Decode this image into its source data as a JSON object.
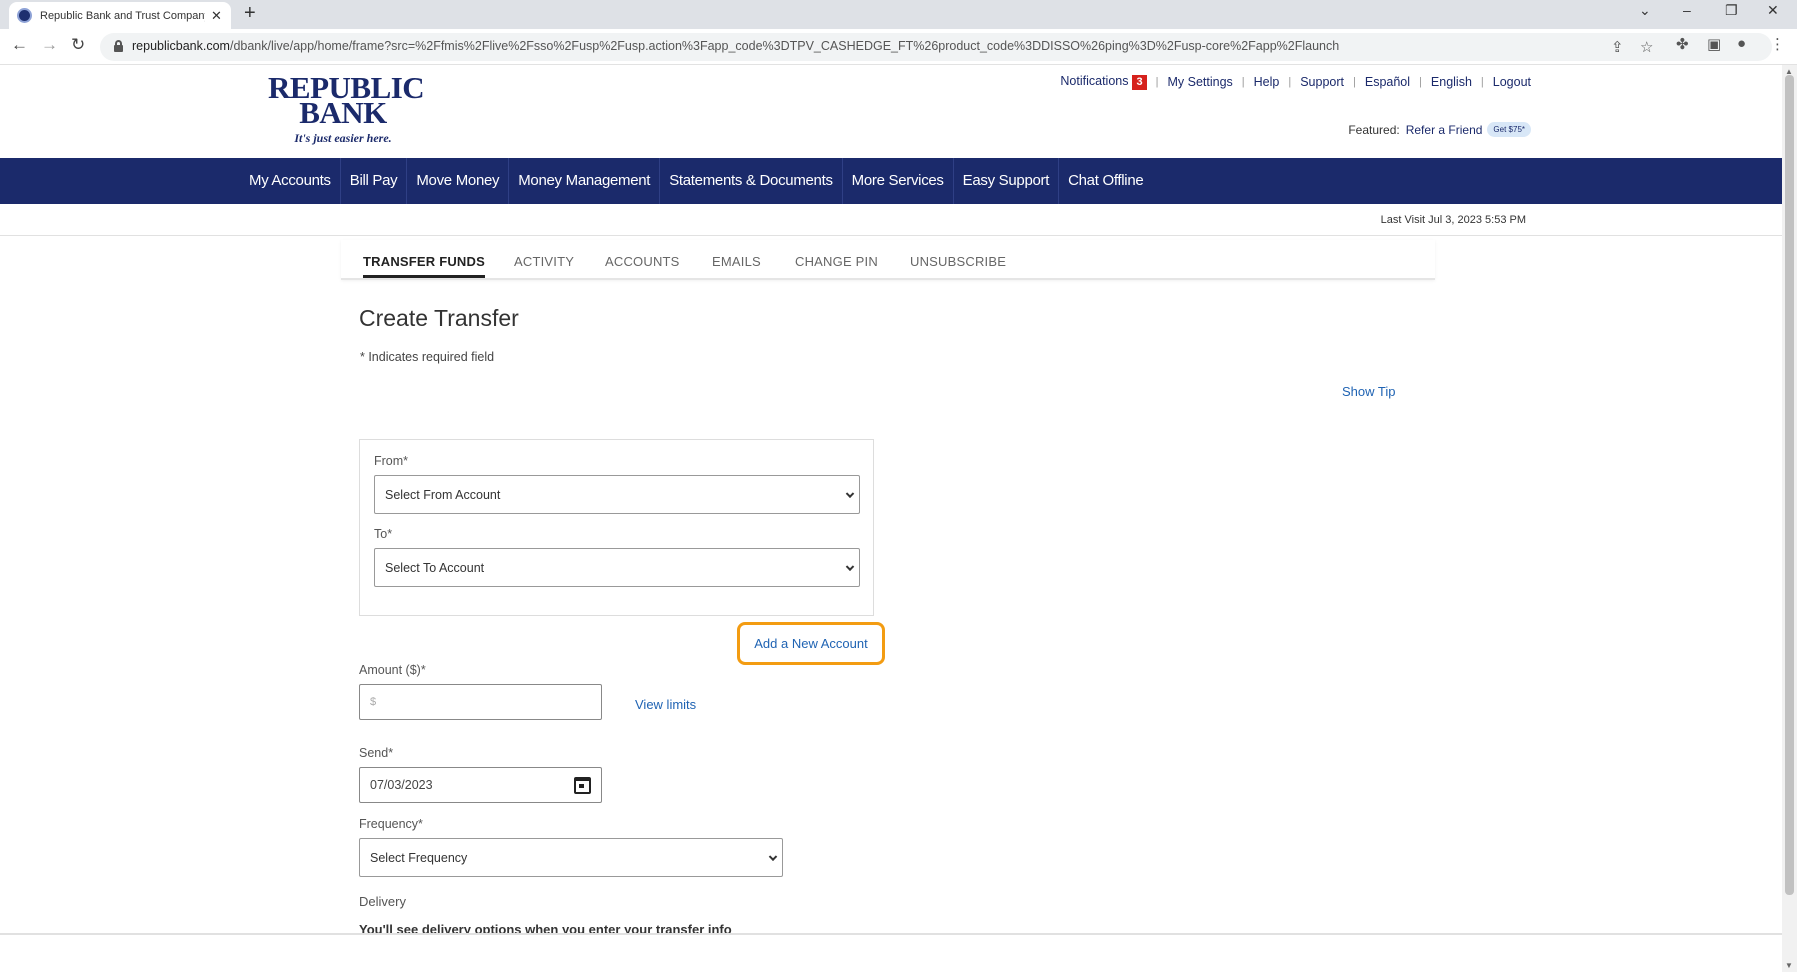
{
  "browser": {
    "tab_title": "Republic Bank and Trust Company",
    "new_tab_label": "+",
    "url_host": "republicbank.com",
    "url_path": "/dbank/live/app/home/frame?src=%2Ffmis%2Flive%2Fsso%2Fusp%2Fusp.action%3Fapp_code%3DTPV_CASHEDGE_FT%26product_code%3DDISSO%26ping%3D%2Fusp-core%2Fapp%2Flaunch"
  },
  "brand": {
    "line1": "REPUBLIC",
    "line2": "BANK",
    "tagline": "It's just easier here.",
    "color": "#1b2a6b"
  },
  "utility_nav": {
    "notifications_label": "Notifications",
    "notifications_count": "3",
    "items": [
      "My Settings",
      "Help",
      "Support",
      "Español",
      "English",
      "Logout"
    ]
  },
  "featured": {
    "label": "Featured:",
    "link": "Refer a Friend",
    "pill": "Get $75*"
  },
  "main_nav": {
    "items": [
      "My Accounts",
      "Bill Pay",
      "Move Money",
      "Money Management",
      "Statements & Documents",
      "More Services",
      "Easy Support",
      "Chat Offline"
    ]
  },
  "last_visit": "Last Visit Jul 3, 2023 5:53 PM",
  "sub_tabs": [
    "TRANSFER FUNDS",
    "ACTIVITY",
    "ACCOUNTS",
    "EMAILS",
    "CHANGE PIN",
    "UNSUBSCRIBE"
  ],
  "form": {
    "title": "Create Transfer",
    "required_note": "* Indicates required field",
    "show_tip": "Show Tip",
    "from_label": "From*",
    "from_value": "Select From Account",
    "to_label": "To*",
    "to_value": "Select To Account",
    "add_account": "Add a New Account",
    "amount_label": "Amount ($)*",
    "amount_placeholder": "$",
    "view_limits": "View limits",
    "send_label": "Send*",
    "send_value": "07/03/2023",
    "frequency_label": "Frequency*",
    "frequency_value": "Select Frequency",
    "delivery_label": "Delivery",
    "delivery_note": "You'll see delivery options when you enter your transfer info"
  },
  "colors": {
    "nav_bg": "#1b2a6b",
    "link": "#1f63b3",
    "highlight": "#f39c12",
    "badge": "#d6211c"
  }
}
